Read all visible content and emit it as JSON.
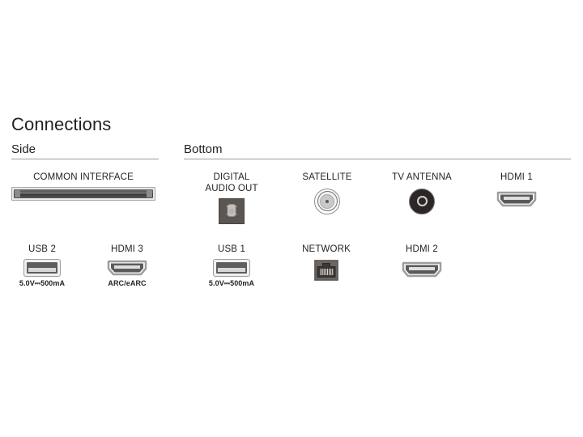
{
  "page": {
    "title": "Connections",
    "background_color": "#ffffff",
    "text_color": "#231f20"
  },
  "sections": {
    "side": {
      "label": "Side"
    },
    "bottom": {
      "label": "Bottom"
    }
  },
  "ports": {
    "common_interface": {
      "label": "COMMON INTERFACE",
      "icon": "ci-slot-icon",
      "section": "side"
    },
    "usb2": {
      "label": "USB 2",
      "sublabel": "5.0V⎓500mA",
      "icon": "usb-port-icon",
      "section": "side"
    },
    "hdmi3": {
      "label": "HDMI 3",
      "sublabel": "ARC/eARC",
      "icon": "hdmi-port-icon",
      "section": "side"
    },
    "digital_audio_out": {
      "label": "DIGITAL\nAUDIO OUT",
      "icon": "optical-audio-icon",
      "section": "bottom"
    },
    "satellite": {
      "label": "SATELLITE",
      "icon": "f-connector-icon",
      "section": "bottom"
    },
    "tv_antenna": {
      "label": "TV ANTENNA",
      "icon": "coax-connector-icon",
      "section": "bottom"
    },
    "hdmi1": {
      "label": "HDMI 1",
      "icon": "hdmi-port-icon",
      "section": "bottom"
    },
    "usb1": {
      "label": "USB 1",
      "sublabel": "5.0V⎓500mA",
      "icon": "usb-port-icon",
      "section": "bottom"
    },
    "network": {
      "label": "NETWORK",
      "icon": "rj45-port-icon",
      "section": "bottom"
    },
    "hdmi2": {
      "label": "HDMI 2",
      "icon": "hdmi-port-icon",
      "section": "bottom"
    }
  }
}
